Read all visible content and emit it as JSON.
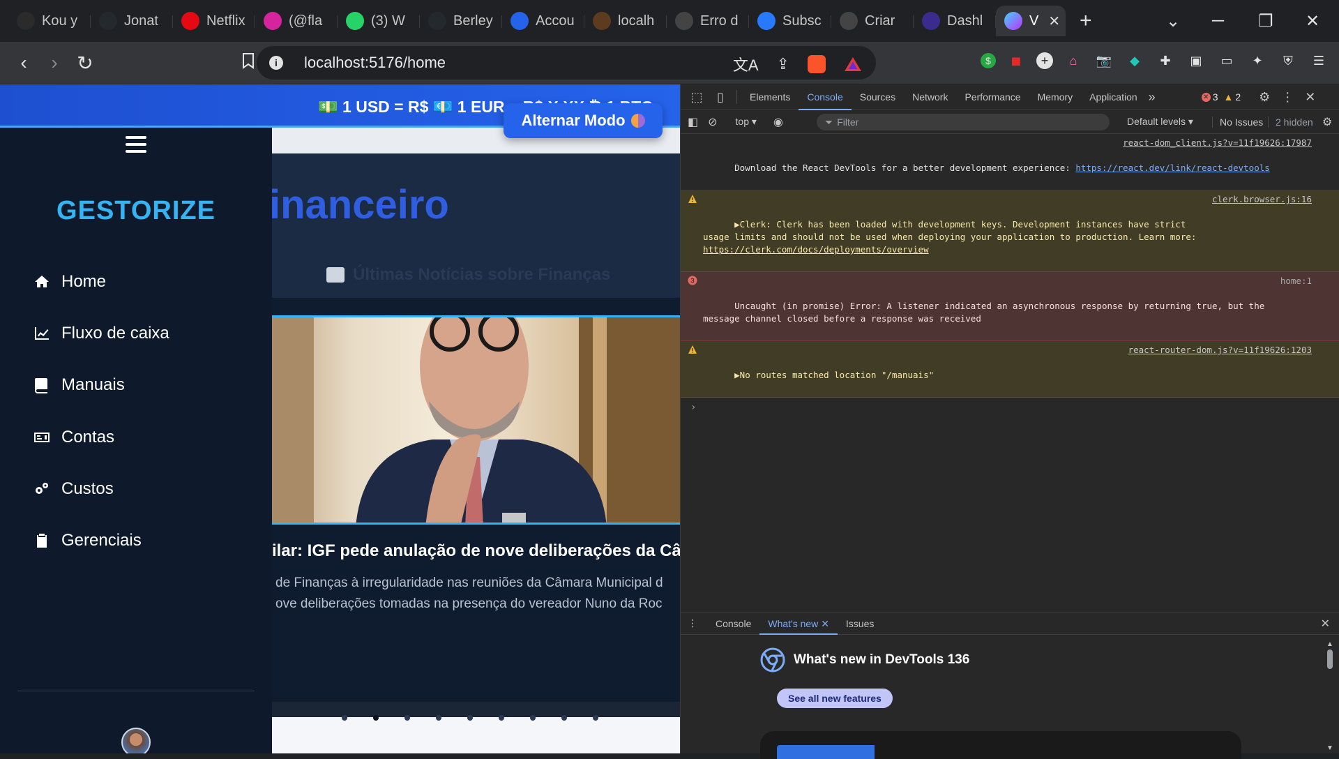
{
  "browser": {
    "tabs": [
      {
        "label": "Kou y",
        "favicon": "kou-icon",
        "color": "#2b2b2b"
      },
      {
        "label": "Jonat",
        "favicon": "github-icon",
        "color": "#24292e"
      },
      {
        "label": "Netflix",
        "favicon": "netflix-icon",
        "color": "#e50914"
      },
      {
        "label": "(@fla",
        "favicon": "instagram-icon",
        "color": "#d6249f"
      },
      {
        "label": "(3) W",
        "favicon": "whatsapp-icon",
        "color": "#25d366"
      },
      {
        "label": "Berley",
        "favicon": "github-icon",
        "color": "#24292e"
      },
      {
        "label": "Accou",
        "favicon": "account-icon",
        "color": "#2563eb"
      },
      {
        "label": "localh",
        "favicon": "localhost-icon",
        "color": "#5c3b1e"
      },
      {
        "label": "Erro d",
        "favicon": "openai-icon",
        "color": "#444"
      },
      {
        "label": "Subsc",
        "favicon": "subscribe-icon",
        "color": "#2979ff"
      },
      {
        "label": "Criar",
        "favicon": "openai-icon",
        "color": "#444"
      },
      {
        "label": "Dashl",
        "favicon": "dashboard-icon",
        "color": "#3b2b8f"
      }
    ],
    "active_tab": {
      "label": "V",
      "favicon": "vite-icon"
    },
    "url": "localhost:5176/home"
  },
  "app": {
    "ticker": "💵 1 USD = R$    💶 1 EUR = R$ X.XX  ₿ 1 BTC",
    "toggle_mode_label": "Alternar Modo",
    "brand": "GESTORIZE",
    "menu": [
      {
        "label": "Home",
        "icon": "home-icon"
      },
      {
        "label": "Fluxo de caixa",
        "icon": "chart-line-icon"
      },
      {
        "label": "Manuais",
        "icon": "book-icon"
      },
      {
        "label": "Contas",
        "icon": "money-card-icon"
      },
      {
        "label": "Custos",
        "icon": "gears-icon"
      },
      {
        "label": "Gerenciais",
        "icon": "clipboard-icon"
      }
    ],
    "hero_title": "inanceiro",
    "news_heading": "Últimas Notícias sobre Finanças",
    "news_title": "ilar: IGF pede anulação de nove deliberações da Câm",
    "news_desc_lines": [
      "de Finanças à irregularidade nas reuniões da Câmara Municipal d",
      "ove deliberações tomadas na presença do vereador Nuno da Roc"
    ]
  },
  "devtools": {
    "tabs": [
      "Elements",
      "Console",
      "Sources",
      "Network",
      "Performance",
      "Memory",
      "Application"
    ],
    "active_tab": "Console",
    "error_count": "3",
    "warning_count": "2",
    "context": "top",
    "filter_placeholder": "Filter",
    "levels": "Default levels",
    "issues": "No Issues",
    "hidden": "2 hidden",
    "messages": [
      {
        "type": "info",
        "source": "react-dom_client.js?v=11f19626:17987",
        "text": "Download the React DevTools for a better development experience: ",
        "link": "https://react.dev/link/react-devtools"
      },
      {
        "type": "warn",
        "source": "clerk.browser.js:16",
        "text": "▶Clerk: Clerk has been loaded with development keys. Development instances have strict\nusage limits and should not be used when deploying your application to production. Learn more:\n",
        "link": "https://clerk.com/docs/deployments/overview"
      },
      {
        "type": "err",
        "source": "home:1",
        "text": "Uncaught (in promise) Error: A listener indicated an asynchronous response by returning true, but the\nmessage channel closed before a response was received",
        "link": ""
      },
      {
        "type": "warn",
        "source": "react-router-dom.js?v=11f19626:1203",
        "text": "▶No routes matched location \"/manuais\"",
        "link": ""
      }
    ],
    "drawer": {
      "tabs": [
        "Console",
        "What's new",
        "Issues"
      ],
      "active_tab": "What's new",
      "title": "What's new in DevTools 136",
      "button": "See all new features"
    }
  }
}
